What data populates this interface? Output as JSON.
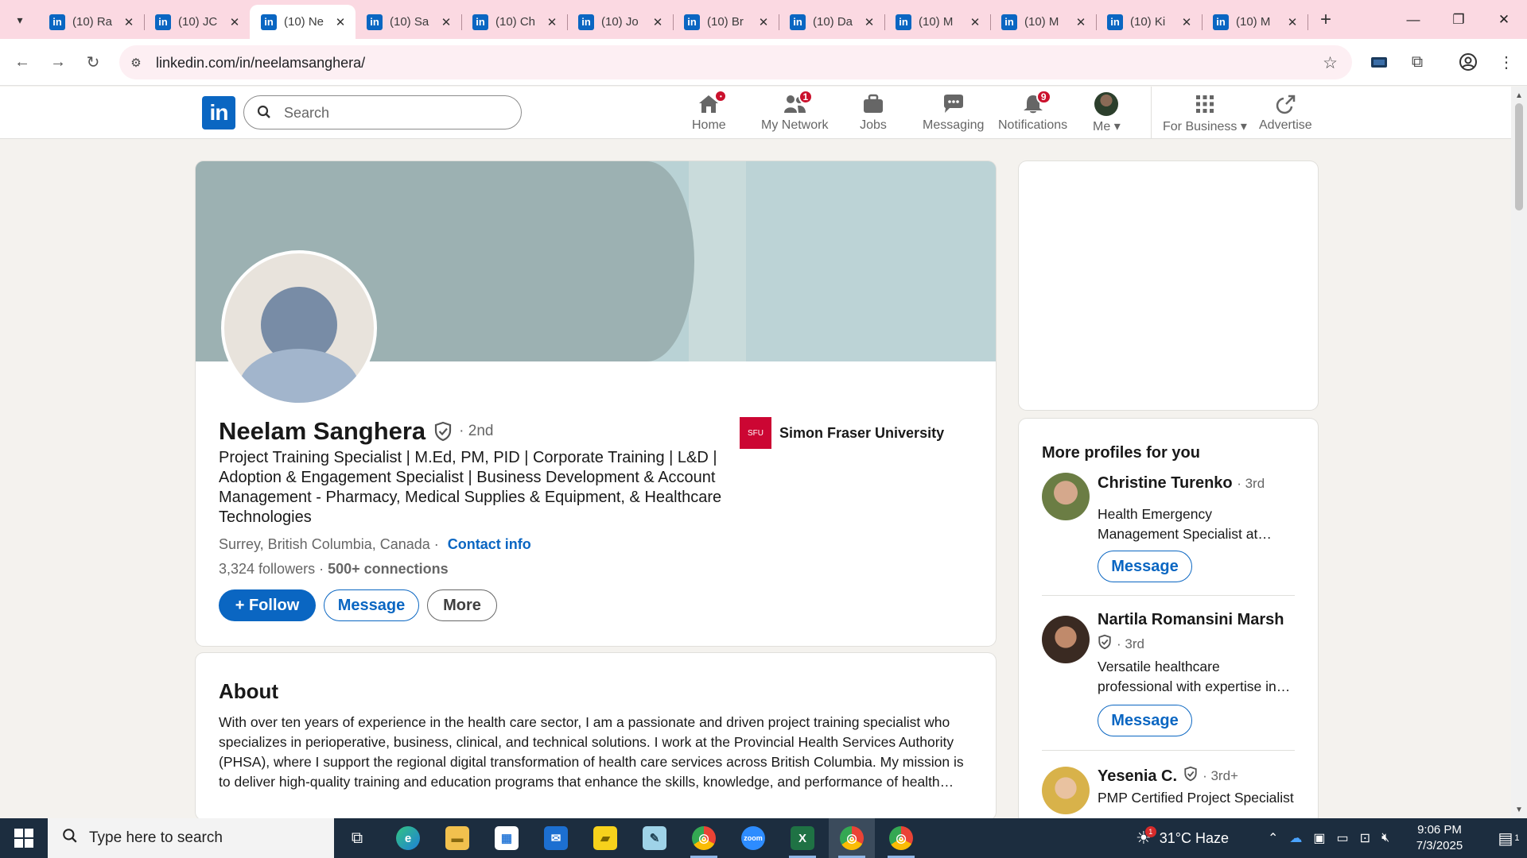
{
  "browser": {
    "tabs": [
      {
        "title": "(10) Ra",
        "active": false
      },
      {
        "title": "(10) JC",
        "active": false
      },
      {
        "title": "(10) Ne",
        "active": true
      },
      {
        "title": "(10) Sa",
        "active": false
      },
      {
        "title": "(10) Ch",
        "active": false
      },
      {
        "title": "(10) Jo",
        "active": false
      },
      {
        "title": "(10) Br",
        "active": false
      },
      {
        "title": "(10) Da",
        "active": false
      },
      {
        "title": "(10) M",
        "active": false
      },
      {
        "title": "(10) M",
        "active": false
      },
      {
        "title": "(10) Ki",
        "active": false
      },
      {
        "title": "(10) M",
        "active": false
      }
    ],
    "favicon_letter": "in",
    "url": "linkedin.com/in/neelamsanghera/",
    "tab_strip_color": "#fbd9e2"
  },
  "linkedin": {
    "logo": "in",
    "search_placeholder": "Search",
    "nav": [
      {
        "label": "Home",
        "icon": "home-icon",
        "badge": "•"
      },
      {
        "label": "My Network",
        "icon": "network-icon",
        "badge": "1"
      },
      {
        "label": "Jobs",
        "icon": "briefcase-icon",
        "badge": ""
      },
      {
        "label": "Messaging",
        "icon": "messaging-icon",
        "badge": ""
      },
      {
        "label": "Notifications",
        "icon": "bell-icon",
        "badge": "9"
      },
      {
        "label": "Me",
        "icon": "avatar",
        "badge": ""
      },
      {
        "label": "For Business",
        "icon": "grid-icon",
        "badge": ""
      },
      {
        "label": "Advertise",
        "icon": "advertise-icon",
        "badge": ""
      }
    ],
    "accent_color": "#0a66c2"
  },
  "profile": {
    "name": "Neelam Sanghera",
    "degree": "· 2nd",
    "headline": "Project Training Specialist | M.Ed, PM, PID | Corporate Training | L&D | Adoption & Engagement Specialist | Business Development & Account Management - Pharmacy, Medical Supplies & Equipment, & Healthcare Technologies",
    "location": "Surrey, British Columbia, Canada ·",
    "contact_info": "Contact info",
    "followers": "3,324 followers",
    "connections": "500+ connections",
    "follow_label": "+ Follow",
    "message_label": "Message",
    "more_label": "More",
    "education": "Simon Fraser University",
    "education_logo_text": "SFU"
  },
  "about": {
    "title": "About",
    "text": "With over ten years of experience in the health care sector, I am a passionate and driven project training specialist who specializes in perioperative, business, clinical, and technical solutions. I work at the Provincial Health Services Authority (PHSA), where I support the regional digital transformation of health care services across British Columbia. My mission is to deliver high-quality training and education programs that enhance the skills, knowledge, and performance of health…"
  },
  "more_profiles": {
    "title": "More profiles for you",
    "people": [
      {
        "name": "Christine Turenko",
        "degree": "· 3rd",
        "verified": false,
        "description": "Health Emergency Management Specialist at…",
        "button": "Message"
      },
      {
        "name": "Nartila Romansini Marsh",
        "degree": "· 3rd",
        "verified": true,
        "description": "Versatile healthcare professional with expertise in…",
        "button": "Message"
      },
      {
        "name": "Yesenia C.",
        "degree": "· 3rd+",
        "verified": true,
        "description": "PMP Certified Project Specialist",
        "button": ""
      }
    ]
  },
  "taskbar": {
    "search_placeholder": "Type here to search",
    "apps": [
      {
        "name": "task-view",
        "glyph": "⧉"
      },
      {
        "name": "edge",
        "glyph": "e"
      },
      {
        "name": "file-explorer",
        "glyph": "▬"
      },
      {
        "name": "store",
        "glyph": "▦"
      },
      {
        "name": "mail",
        "glyph": "✉"
      },
      {
        "name": "sticky-notes",
        "glyph": "▰"
      },
      {
        "name": "notepad",
        "glyph": "✎"
      },
      {
        "name": "chrome-1",
        "glyph": "◎"
      },
      {
        "name": "zoom",
        "glyph": "zoom"
      },
      {
        "name": "excel",
        "glyph": "X"
      },
      {
        "name": "chrome-2",
        "glyph": "◎"
      },
      {
        "name": "chrome-3",
        "glyph": "◎"
      }
    ],
    "weather": "31°C  Haze",
    "weather_badge": "1",
    "time": "9:06 PM",
    "date": "7/3/2025",
    "notification_count": "1"
  }
}
